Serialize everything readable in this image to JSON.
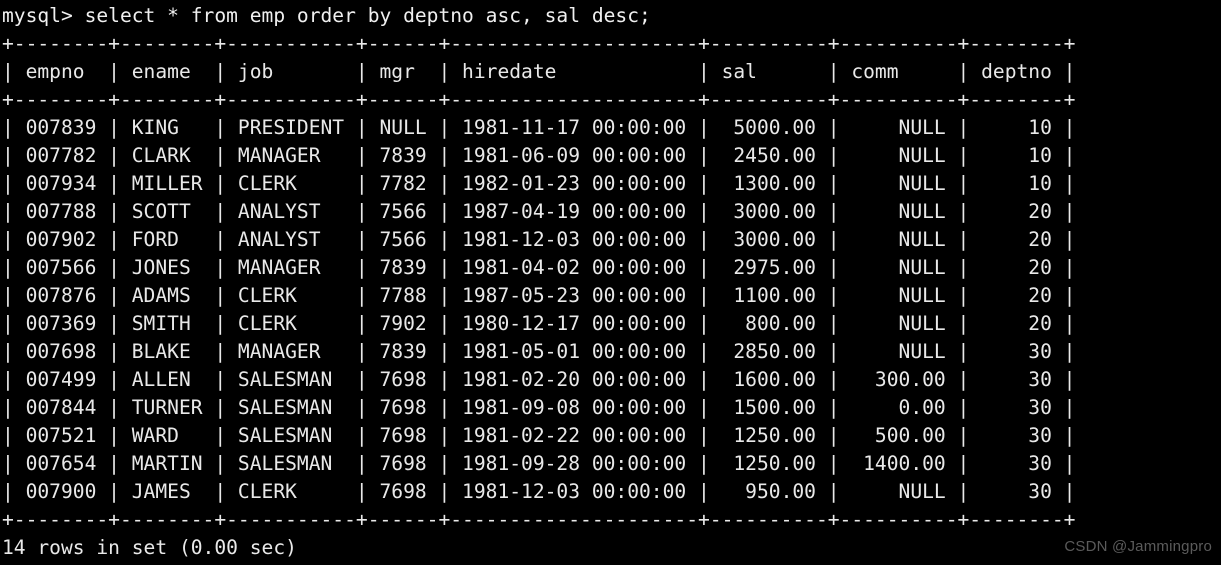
{
  "terminal": {
    "prompt_line": "mysql> select * from emp order by deptno asc, sal desc;",
    "separator": "+--------+--------+-----------+------+---------------------+----------+----------+--------+",
    "header_line": "| empno  | ename  | job       | mgr  | hiredate            | sal      | comm     | deptno |",
    "status_line": "14 rows in set (0.00 sec)",
    "columns": [
      "empno",
      "ename",
      "job",
      "mgr",
      "hiredate",
      "sal",
      "comm",
      "deptno"
    ],
    "rows": [
      {
        "line": "| 007839 | KING   | PRESIDENT | NULL | 1981-11-17 00:00:00 |  5000.00 |     NULL |     10 |",
        "empno": "007839",
        "ename": "KING",
        "job": "PRESIDENT",
        "mgr": "NULL",
        "hiredate": "1981-11-17 00:00:00",
        "sal": "5000.00",
        "comm": "NULL",
        "deptno": "10"
      },
      {
        "line": "| 007782 | CLARK  | MANAGER   | 7839 | 1981-06-09 00:00:00 |  2450.00 |     NULL |     10 |",
        "empno": "007782",
        "ename": "CLARK",
        "job": "MANAGER",
        "mgr": "7839",
        "hiredate": "1981-06-09 00:00:00",
        "sal": "2450.00",
        "comm": "NULL",
        "deptno": "10"
      },
      {
        "line": "| 007934 | MILLER | CLERK     | 7782 | 1982-01-23 00:00:00 |  1300.00 |     NULL |     10 |",
        "empno": "007934",
        "ename": "MILLER",
        "job": "CLERK",
        "mgr": "7782",
        "hiredate": "1982-01-23 00:00:00",
        "sal": "1300.00",
        "comm": "NULL",
        "deptno": "10"
      },
      {
        "line": "| 007788 | SCOTT  | ANALYST   | 7566 | 1987-04-19 00:00:00 |  3000.00 |     NULL |     20 |",
        "empno": "007788",
        "ename": "SCOTT",
        "job": "ANALYST",
        "mgr": "7566",
        "hiredate": "1987-04-19 00:00:00",
        "sal": "3000.00",
        "comm": "NULL",
        "deptno": "20"
      },
      {
        "line": "| 007902 | FORD   | ANALYST   | 7566 | 1981-12-03 00:00:00 |  3000.00 |     NULL |     20 |",
        "empno": "007902",
        "ename": "FORD",
        "job": "ANALYST",
        "mgr": "7566",
        "hiredate": "1981-12-03 00:00:00",
        "sal": "3000.00",
        "comm": "NULL",
        "deptno": "20"
      },
      {
        "line": "| 007566 | JONES  | MANAGER   | 7839 | 1981-04-02 00:00:00 |  2975.00 |     NULL |     20 |",
        "empno": "007566",
        "ename": "JONES",
        "job": "MANAGER",
        "mgr": "7839",
        "hiredate": "1981-04-02 00:00:00",
        "sal": "2975.00",
        "comm": "NULL",
        "deptno": "20"
      },
      {
        "line": "| 007876 | ADAMS  | CLERK     | 7788 | 1987-05-23 00:00:00 |  1100.00 |     NULL |     20 |",
        "empno": "007876",
        "ename": "ADAMS",
        "job": "CLERK",
        "mgr": "7788",
        "hiredate": "1987-05-23 00:00:00",
        "sal": "1100.00",
        "comm": "NULL",
        "deptno": "20"
      },
      {
        "line": "| 007369 | SMITH  | CLERK     | 7902 | 1980-12-17 00:00:00 |   800.00 |     NULL |     20 |",
        "empno": "007369",
        "ename": "SMITH",
        "job": "CLERK",
        "mgr": "7902",
        "hiredate": "1980-12-17 00:00:00",
        "sal": "800.00",
        "comm": "NULL",
        "deptno": "20"
      },
      {
        "line": "| 007698 | BLAKE  | MANAGER   | 7839 | 1981-05-01 00:00:00 |  2850.00 |     NULL |     30 |",
        "empno": "007698",
        "ename": "BLAKE",
        "job": "MANAGER",
        "mgr": "7839",
        "hiredate": "1981-05-01 00:00:00",
        "sal": "2850.00",
        "comm": "NULL",
        "deptno": "30"
      },
      {
        "line": "| 007499 | ALLEN  | SALESMAN  | 7698 | 1981-02-20 00:00:00 |  1600.00 |   300.00 |     30 |",
        "empno": "007499",
        "ename": "ALLEN",
        "job": "SALESMAN",
        "mgr": "7698",
        "hiredate": "1981-02-20 00:00:00",
        "sal": "1600.00",
        "comm": "300.00",
        "deptno": "30"
      },
      {
        "line": "| 007844 | TURNER | SALESMAN  | 7698 | 1981-09-08 00:00:00 |  1500.00 |     0.00 |     30 |",
        "empno": "007844",
        "ename": "TURNER",
        "job": "SALESMAN",
        "mgr": "7698",
        "hiredate": "1981-09-08 00:00:00",
        "sal": "1500.00",
        "comm": "0.00",
        "deptno": "30"
      },
      {
        "line": "| 007521 | WARD   | SALESMAN  | 7698 | 1981-02-22 00:00:00 |  1250.00 |   500.00 |     30 |",
        "empno": "007521",
        "ename": "WARD",
        "job": "SALESMAN",
        "mgr": "7698",
        "hiredate": "1981-02-22 00:00:00",
        "sal": "1250.00",
        "comm": "500.00",
        "deptno": "30"
      },
      {
        "line": "| 007654 | MARTIN | SALESMAN  | 7698 | 1981-09-28 00:00:00 |  1250.00 |  1400.00 |     30 |",
        "empno": "007654",
        "ename": "MARTIN",
        "job": "SALESMAN",
        "mgr": "7698",
        "hiredate": "1981-09-28 00:00:00",
        "sal": "1250.00",
        "comm": "1400.00",
        "deptno": "30"
      },
      {
        "line": "| 007900 | JAMES  | CLERK     | 7698 | 1981-12-03 00:00:00 |   950.00 |     NULL |     30 |",
        "empno": "007900",
        "ename": "JAMES",
        "job": "CLERK",
        "mgr": "7698",
        "hiredate": "1981-12-03 00:00:00",
        "sal": "950.00",
        "comm": "NULL",
        "deptno": "30"
      }
    ]
  },
  "watermark": {
    "text": "CSDN @Jammingpro"
  },
  "colors": {
    "background": "#000000",
    "foreground": "#e9e9e9",
    "watermark": "#5b5b5b"
  }
}
